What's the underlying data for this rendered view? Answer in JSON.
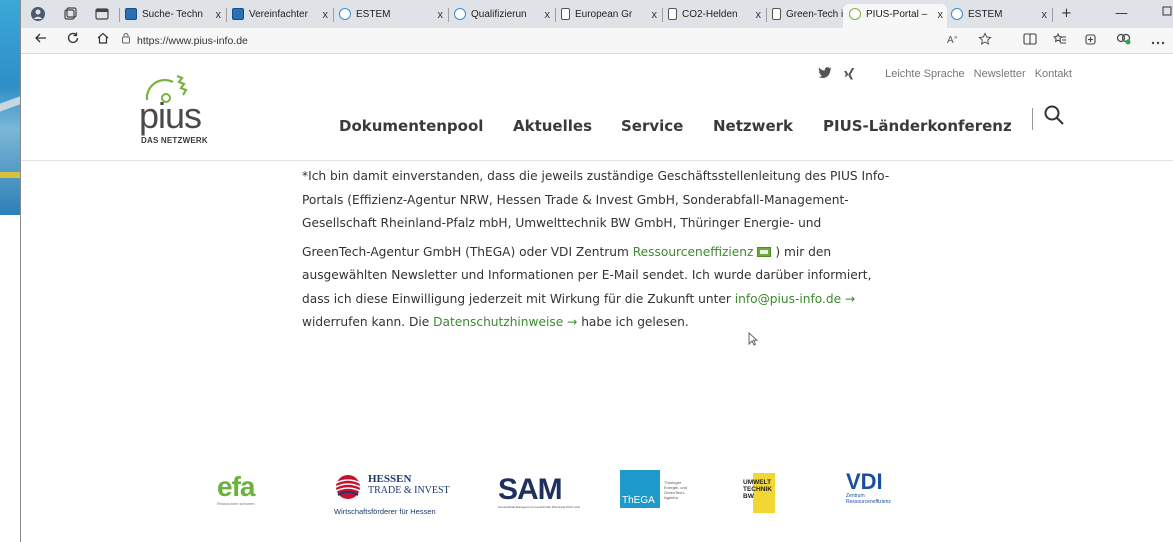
{
  "browser": {
    "tabs": [
      {
        "label": "Suche- Techn",
        "icon": "blue-favicon"
      },
      {
        "label": "Vereinfachter",
        "icon": "blue-favicon"
      },
      {
        "label": "ESTEM",
        "icon": "globe-favicon"
      },
      {
        "label": "Qualifizierun",
        "icon": "globe-favicon"
      },
      {
        "label": "European Gr",
        "icon": "document-favicon"
      },
      {
        "label": "CO2-Helden",
        "icon": "document-favicon"
      },
      {
        "label": "Green-Tech i",
        "icon": "document-favicon"
      },
      {
        "label": "PIUS-Portal –",
        "icon": "pius-favicon",
        "active": true
      },
      {
        "label": "ESTEM",
        "icon": "globe-favicon"
      }
    ],
    "url": "https://www.pius-info.de",
    "new_tab": "+",
    "minimize": "—",
    "close_glyph": "x"
  },
  "site": {
    "logo_text": "pius",
    "logo_tagline": "DAS NETZWERK",
    "top_links": [
      "Leichte Sprache",
      "Newsletter",
      "Kontakt"
    ],
    "nav": [
      "Dokumentenpool",
      "Aktuelles",
      "Service",
      "Netzwerk",
      "PIUS-Länderkonferenz"
    ]
  },
  "consent": {
    "line1": "*Ich bin damit einverstanden, dass die jeweils zuständige Geschäftsstellenleitung des PIUS Info-",
    "line2": "Portals (Effizienz-Agentur NRW, Hessen Trade & Invest GmbH, Sonderabfall-Management-",
    "line3": "Gesellschaft Rheinland-Pfalz mbH, Umwelttechnik BW GmbH, Thüringer Energie- und",
    "line4_pre": "GreenTech-Agentur GmbH (ThEGA) oder VDI Zentrum ",
    "line4_link": "Ressourceneffizienz",
    "line4_post": ") mir den",
    "line5": "ausgewählten Newsletter und Informationen per E-Mail sendet. Ich wurde darüber informiert,",
    "line6_pre": "dass ich diese Einwilligung jederzeit mit Wirkung für die Zukunft unter ",
    "line6_link": "info@pius-info.de →",
    "line7_pre": "widerrufen kann. Die ",
    "line7_link": "Datenschutzhinweise →",
    "line7_post": " habe ich gelesen."
  },
  "partners": {
    "efa": {
      "main": "efa",
      "sub": "Ressourcen schonen"
    },
    "hessen": {
      "t1": "HESSEN",
      "t2": "TRADE & INVEST",
      "t3": "Wirtschaftsförderer für Hessen"
    },
    "sam": {
      "main": "SAM",
      "sub": "Sonderabfall-Management-Gesellschaft Rheinland-Pfalz mbH"
    },
    "thega": {
      "main": "ThEGA",
      "sub1": "Thüringer",
      "sub2": "Energie- und",
      "sub3": "GreenTech-",
      "sub4": "Agentur"
    },
    "umwelt": {
      "l1": "UMWELT",
      "l2": "TECHNIK",
      "l3": "BW"
    },
    "vdi": {
      "main": "VDI",
      "sub1": "Zentrum",
      "sub2": "Ressourceneffizienz"
    }
  },
  "colors": {
    "link_green": "#3c8a2e",
    "pius_green": "#79b241",
    "text": "#333333"
  }
}
